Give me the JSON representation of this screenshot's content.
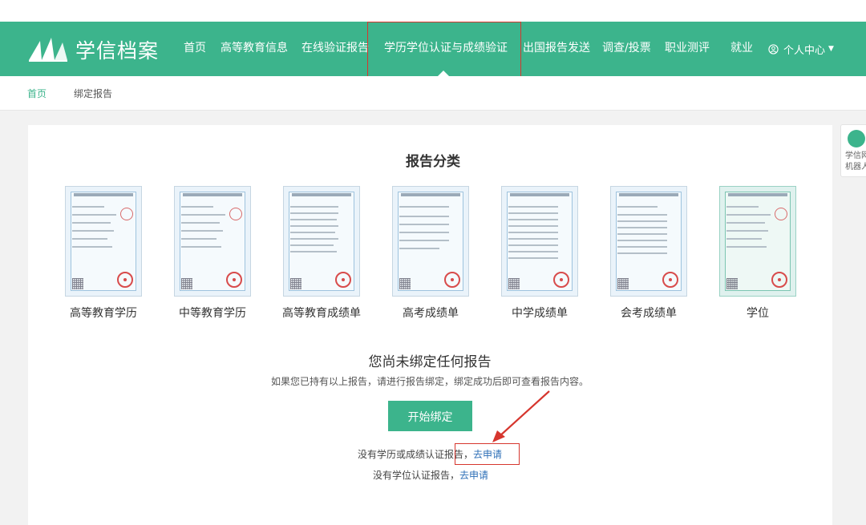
{
  "brand": {
    "name": "学信档案"
  },
  "nav": {
    "items": [
      {
        "label": "首页"
      },
      {
        "label": "高等教育信息"
      },
      {
        "label": "在线验证报告"
      },
      {
        "label": "学历学位认证与成绩验证"
      },
      {
        "label": "出国报告发送"
      },
      {
        "label": "调查/投票"
      },
      {
        "label": "职业测评"
      },
      {
        "label": "就业"
      }
    ],
    "active_index": 3,
    "user_menu_label": "个人中心"
  },
  "breadcrumb": {
    "home": "首页",
    "current": "绑定报告"
  },
  "robot": {
    "label_line1": "学信网",
    "label_line2": "机器人"
  },
  "main": {
    "section_title": "报告分类",
    "report_types": [
      {
        "label": "高等教育学历"
      },
      {
        "label": "中等教育学历"
      },
      {
        "label": "高等教育成绩单"
      },
      {
        "label": "高考成绩单"
      },
      {
        "label": "中学成绩单"
      },
      {
        "label": "会考成绩单"
      },
      {
        "label": "学位"
      }
    ],
    "empty_title": "您尚未绑定任何报告",
    "empty_desc": "如果您已持有以上报告，请进行报告绑定，绑定成功后即可查看报告内容。",
    "start_button": "开始绑定",
    "apply_line1_text": "没有学历或成绩认证报告，",
    "apply_line1_link": "去申请",
    "apply_line2_text": "没有学位认证报告，",
    "apply_line2_link": "去申请"
  },
  "colors": {
    "brand_green": "#3cb48c",
    "highlight_red": "#d6362e",
    "link_blue": "#2e6fb7"
  }
}
